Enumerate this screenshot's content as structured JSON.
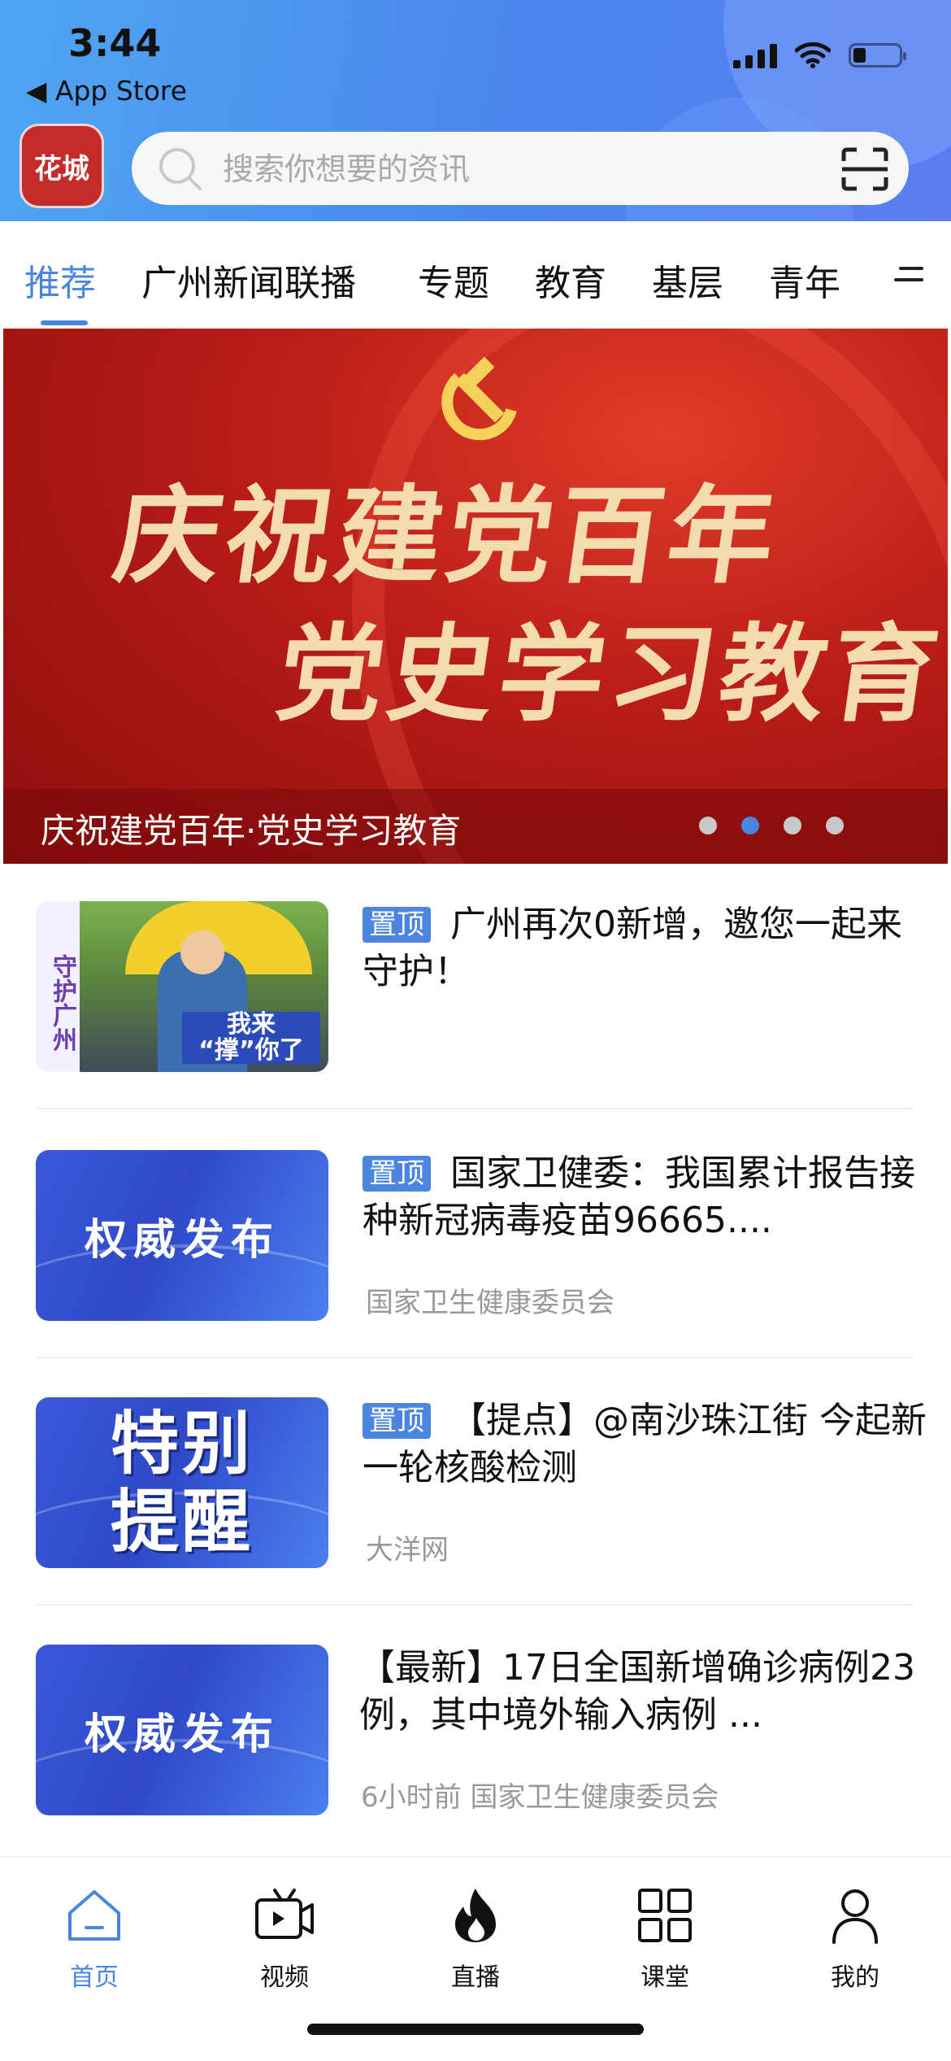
{
  "status_bar": {
    "time": "3:44",
    "back_label": "App Store"
  },
  "header": {
    "logo_text": "花城",
    "search_placeholder": "搜索你想要的资讯"
  },
  "tabs": [
    {
      "label": "推荐"
    },
    {
      "label": "广州新闻联播"
    },
    {
      "label": "专题"
    },
    {
      "label": "教育"
    },
    {
      "label": "基层"
    },
    {
      "label": "青年"
    }
  ],
  "banner": {
    "slogan_line1": "庆祝建党百年",
    "slogan_line2": "党史学习教育",
    "caption": "庆祝建党百年·党史学习教育",
    "active_dot_index": 2,
    "dot_count": 4
  },
  "news": [
    {
      "pinned": true,
      "badge": "置顶",
      "title": "广州再次0新增，邀您一起来守护！",
      "meta": "",
      "thumb": {
        "side_text": "守护广州",
        "tag_line1": "我来",
        "tag_line2": "“撑”你了"
      }
    },
    {
      "pinned": true,
      "badge": "置顶",
      "title": "国家卫健委：我国累计报告接种新冠病毒疫苗96665....",
      "meta": "国家卫生健康委员会",
      "thumb": {
        "text": "权威发布"
      }
    },
    {
      "pinned": true,
      "badge": "置顶",
      "title": "【提点】@南沙珠江街 今起新一轮核酸检测",
      "meta": "大洋网",
      "thumb": {
        "text_line1": "特别",
        "text_line2": "提醒"
      }
    },
    {
      "pinned": false,
      "badge": "",
      "title": "【最新】17日全国新增确诊病例23例，其中境外输入病例 ...",
      "meta": "6小时前 国家卫生健康委员会",
      "thumb": {
        "text": "权威发布"
      }
    }
  ],
  "tabbar": [
    {
      "label": "首页",
      "icon": "home-icon",
      "active": true
    },
    {
      "label": "视频",
      "icon": "tv-icon",
      "active": false
    },
    {
      "label": "直播",
      "icon": "flame-icon",
      "active": false
    },
    {
      "label": "课堂",
      "icon": "grid-icon",
      "active": false
    },
    {
      "label": "我的",
      "icon": "person-icon",
      "active": false
    }
  ],
  "colors": {
    "accent": "#4a86e0",
    "header_blue": "#4a86ee",
    "banner_red": "#b81c16"
  }
}
